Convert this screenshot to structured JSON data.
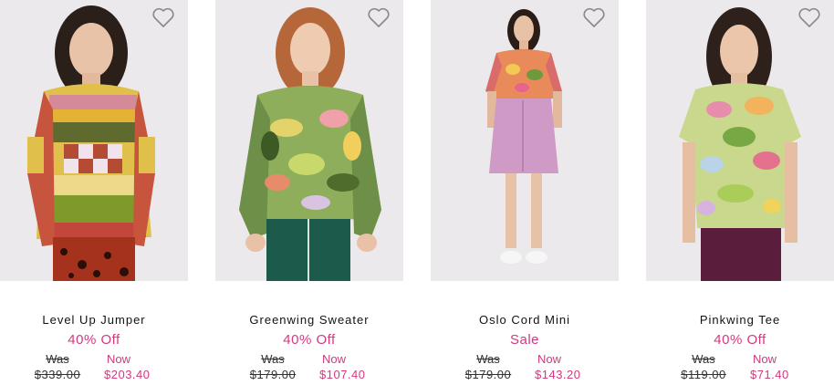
{
  "products": [
    {
      "name": "Level Up Jumper",
      "discount": "40% Off",
      "was_label": "Was",
      "was_price": "$339.00",
      "now_label": "Now",
      "now_price": "$203.40"
    },
    {
      "name": "Greenwing Sweater",
      "discount": "40% Off",
      "was_label": "Was",
      "was_price": "$179.00",
      "now_label": "Now",
      "now_price": "$107.40"
    },
    {
      "name": "Oslo Cord Mini",
      "discount": "Sale",
      "was_label": "Was",
      "was_price": "$179.00",
      "now_label": "Now",
      "now_price": "$143.20"
    },
    {
      "name": "Pinkwing Tee",
      "discount": "40% Off",
      "was_label": "Was",
      "was_price": "$119.00",
      "now_label": "Now",
      "now_price": "$71.40"
    }
  ],
  "colors": {
    "accent": "#d2397e",
    "text": "#111111",
    "photo_bg": "#eceaec"
  },
  "icons": {
    "wishlist": "heart-outline-icon"
  }
}
